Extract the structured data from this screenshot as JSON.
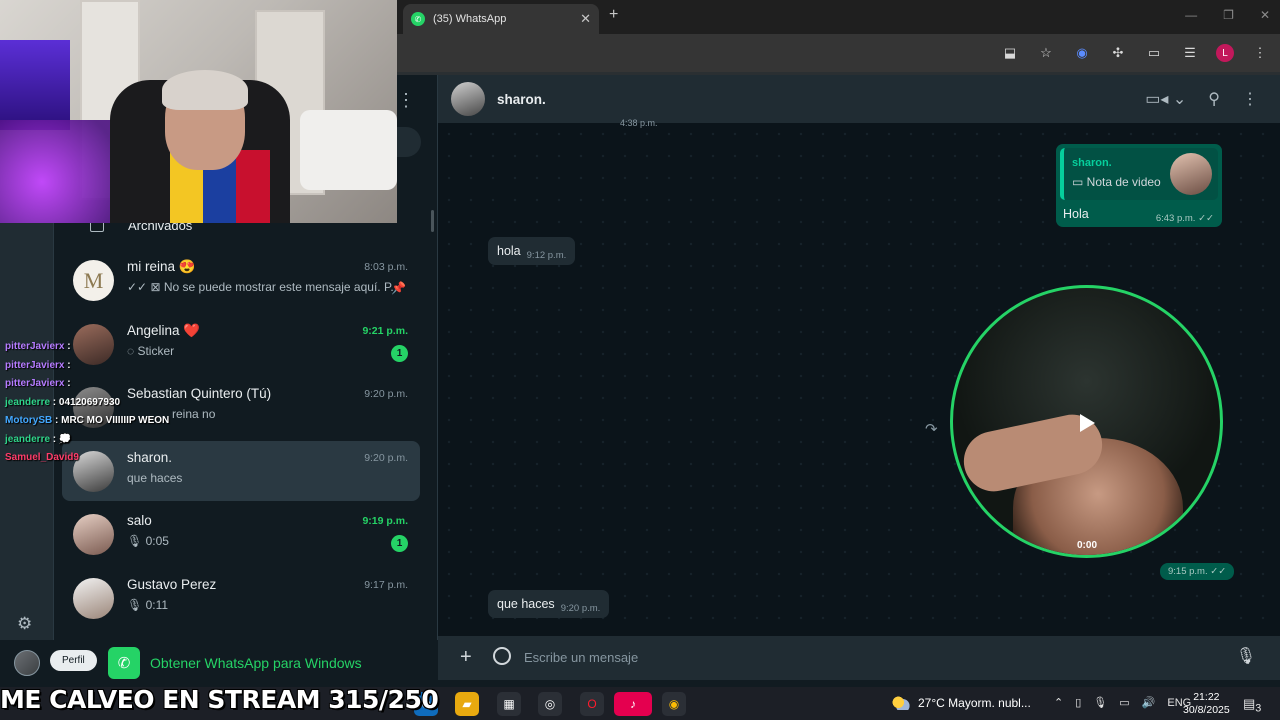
{
  "browser": {
    "tab_title": "(35) WhatsApp",
    "new_tab": "+",
    "tab_close": "✕",
    "window_controls": [
      "—",
      "❐",
      "✕"
    ],
    "profile_letter": "L",
    "toolbar_icons": [
      "install-icon",
      "star-icon",
      "extension-blue-icon",
      "puzzle-icon",
      "cast-icon",
      "reading-list-icon"
    ]
  },
  "left_panel": {
    "archived_label": "Archivados",
    "chats": [
      {
        "name": "mi reina 😍",
        "time": "8:03 p.m.",
        "time_green": false,
        "preview": "✓✓ ⊠ No se puede mostrar este mensaje aquí. P...",
        "badge": "",
        "pinned": true
      },
      {
        "name": "Angelina ❤️",
        "time": "9:21 p.m.",
        "time_green": true,
        "preview": "◌ Sticker",
        "badge": "1",
        "pinned": false
      },
      {
        "name": "Sebastian Quintero (Tú)",
        "time": "9:20 p.m.",
        "time_green": false,
        "preview": "reina no",
        "badge": "",
        "pinned": false
      },
      {
        "name": "sharon.",
        "time": "9:20 p.m.",
        "time_green": false,
        "preview": "que haces",
        "badge": "",
        "pinned": false
      },
      {
        "name": "salo",
        "time": "9:19 p.m.",
        "time_green": true,
        "preview": "🎙 0:05",
        "badge": "1",
        "pinned": false
      },
      {
        "name": "Gustavo Perez",
        "time": "9:17 p.m.",
        "time_green": false,
        "preview": "🎙 0:11",
        "badge": "",
        "pinned": false
      }
    ],
    "perfil_tooltip": "Perfil",
    "get_windows": "Obtener WhatsApp para Windows"
  },
  "twitch_chat": [
    {
      "user": "pitterJavierx",
      "sep": " : ",
      "msg": "",
      "color": "u1"
    },
    {
      "user": "pitterJavierx",
      "sep": " : ",
      "msg": "",
      "color": "u1"
    },
    {
      "user": "pitterJavierx",
      "sep": " : ",
      "msg": "",
      "color": "u1"
    },
    {
      "user": "jeanderre",
      "sep": " : ",
      "msg": "04120697930",
      "color": "u2"
    },
    {
      "user": "MotorySB",
      "sep": " : ",
      "msg": "MRC MO VIIIIIIP WEON",
      "color": "u2"
    },
    {
      "user": "jeanderre",
      "sep": " : ",
      "msg": "💭",
      "color": "u2"
    },
    {
      "user": "Samuel_David9",
      "sep": "",
      "msg": "",
      "color": "u3"
    }
  ],
  "conversation": {
    "contact_name": "sharon.",
    "old_time": "4:38 p.m.",
    "reply_bubble": {
      "quote_name": "sharon.",
      "quote_type": "Nota de video",
      "text": "Hola",
      "time": "6:43 p.m. ✓✓"
    },
    "msg_hola": {
      "text": "hola",
      "time": "9:12 p.m."
    },
    "video_note": {
      "duration": "0:00",
      "time": "9:15 p.m. ✓✓"
    },
    "msg_last": {
      "text": "que haces",
      "time": "9:20 p.m."
    },
    "composer_placeholder": "Escribe un mensaje"
  },
  "stream_banner": "ME CALVEO EN STREAM 315/250",
  "taskbar": {
    "weather": "27°C  Mayorm. nubl...",
    "lang": "ENG",
    "time": "21:22",
    "date": "30/8/2025",
    "notif_count": "3"
  }
}
